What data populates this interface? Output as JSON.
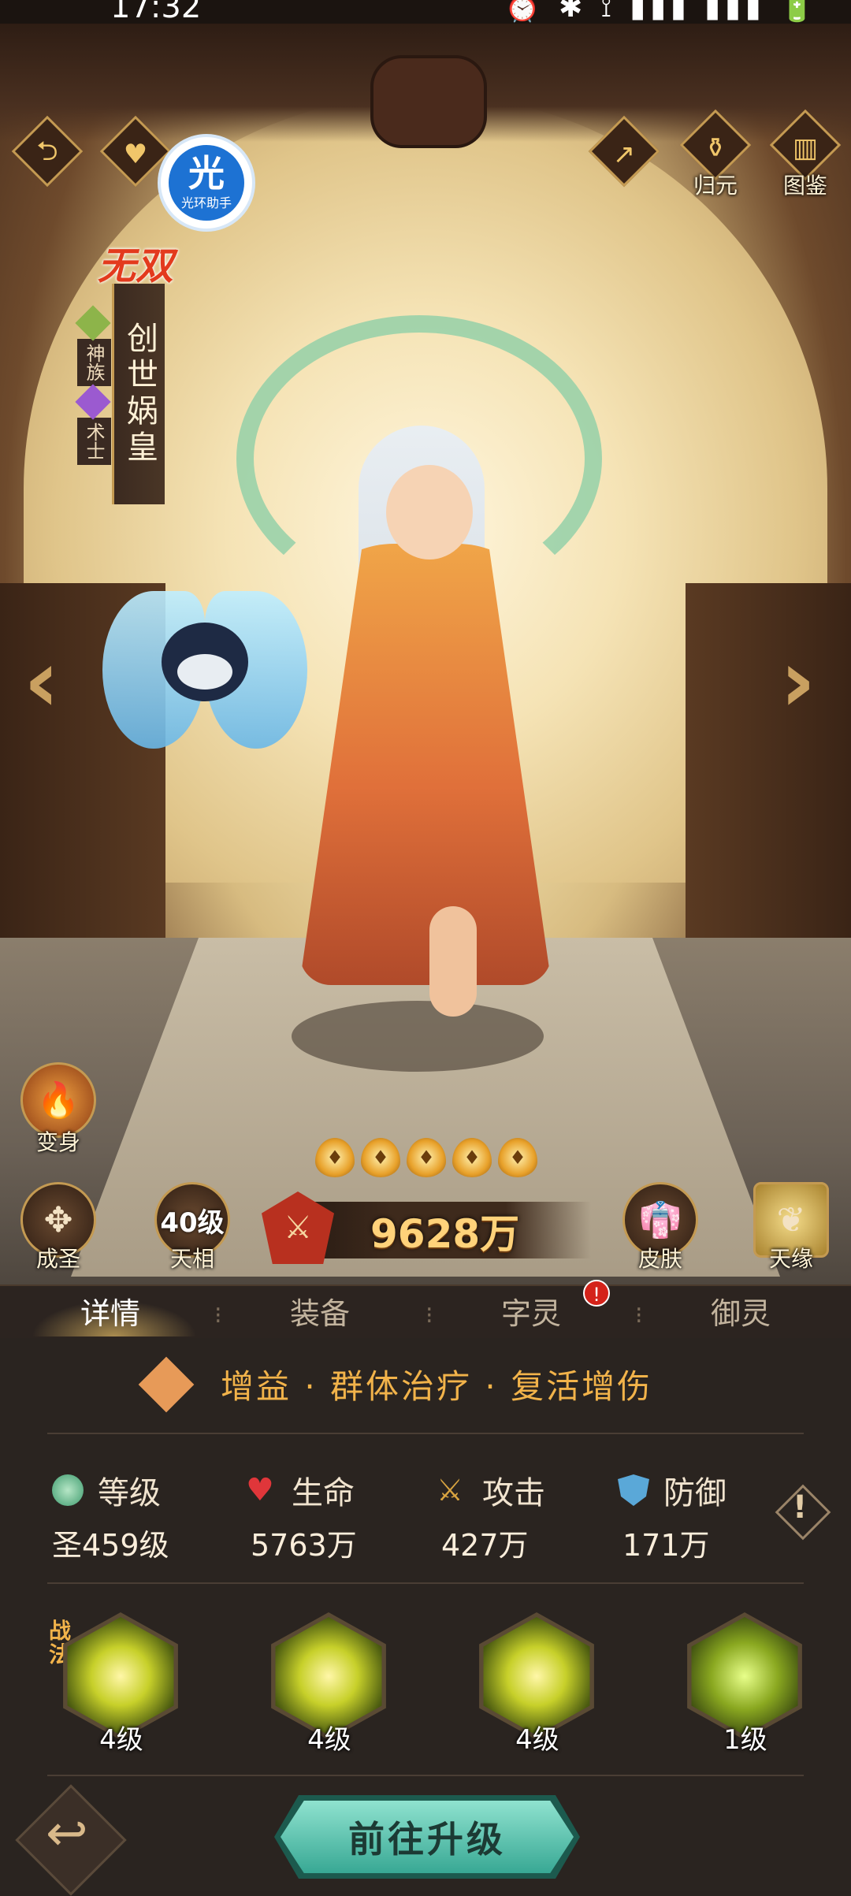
{
  "status_bar": {
    "time": "17:32",
    "icons": "⏰ ✱ ⟟ ▮▮▮ ▮▮▮ 🔋"
  },
  "top_right": {
    "guiyuan_label": "归元",
    "tujian_label": "图鉴"
  },
  "helper": {
    "big": "光",
    "small": "光环助手"
  },
  "hero": {
    "rank_tag": "无双",
    "name": "创世娲皇",
    "race": "神族",
    "class": "术士",
    "stars": 5,
    "power": "9628万"
  },
  "side_buttons": {
    "transform_label": "变身",
    "chengsheng_label": "成圣",
    "tianxiang_level": "40级",
    "tianxiang_label": "天相",
    "skin_label": "皮肤",
    "tianyuan_label": "天缘"
  },
  "tabs": [
    {
      "label": "详情",
      "active": true
    },
    {
      "label": "装备",
      "active": false
    },
    {
      "label": "字灵",
      "active": false,
      "badge": "!"
    },
    {
      "label": "御灵",
      "active": false
    }
  ],
  "traits": "增益 · 群体治疗 · 复活增伤",
  "stats": [
    {
      "icon": "level-icon",
      "label": "等级",
      "value": "圣459级",
      "color": "#3e9b6e"
    },
    {
      "icon": "heart-icon",
      "label": "生命",
      "value": "5763万",
      "color": "#e0363a"
    },
    {
      "icon": "swords-icon",
      "label": "攻击",
      "value": "427万",
      "color": "#d9a440"
    },
    {
      "icon": "shield-icon",
      "label": "防御",
      "value": "171万",
      "color": "#5aa8d8"
    }
  ],
  "skills": [
    {
      "level": "4级",
      "tag": "战法"
    },
    {
      "level": "4级"
    },
    {
      "level": "4级"
    },
    {
      "level": "1级"
    }
  ],
  "upgrade_label": "前往升级",
  "info_glyph": "!"
}
